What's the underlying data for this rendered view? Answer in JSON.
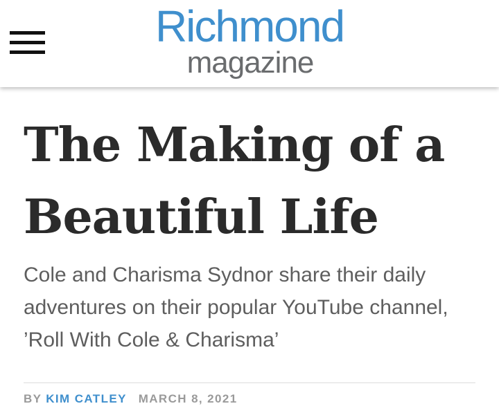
{
  "header": {
    "logo_line1": "Richmond",
    "logo_line2": "magazine",
    "menu_icon": "hamburger-menu-icon",
    "logo_color": "#3f8fcd",
    "logo_sub_color": "#6a6c6e"
  },
  "article": {
    "title": "The Making of a Beautiful Life",
    "dek": "Cole and Charisma Sydnor share their daily adventures on their popular YouTube channel, ’Roll With Cole & Charisma’",
    "byline_prefix": "BY",
    "author": "KIM CATLEY",
    "date": "MARCH 8, 2021"
  }
}
